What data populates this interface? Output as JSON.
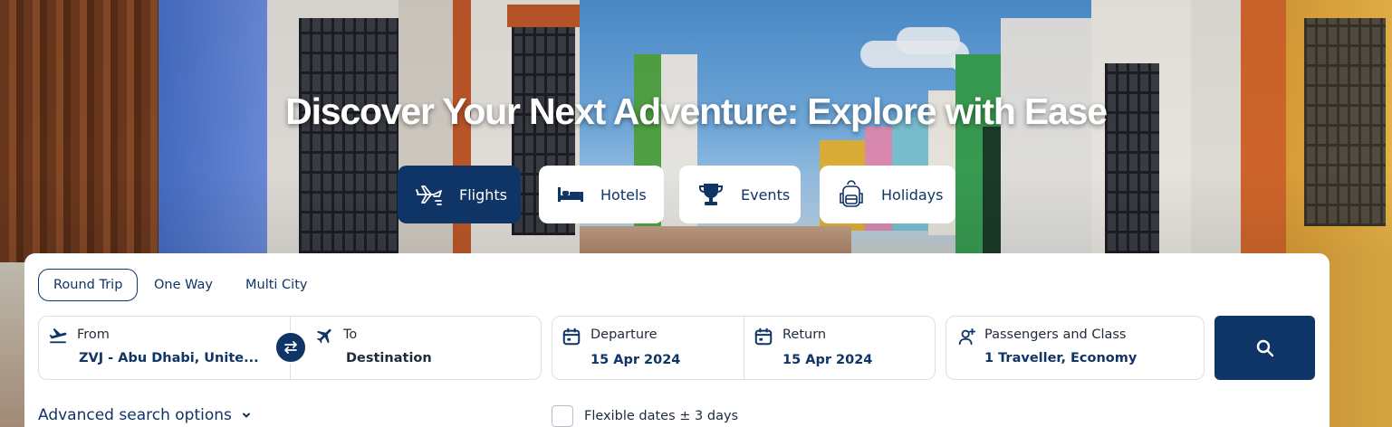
{
  "hero": {
    "headline": "Discover Your Next Adventure: Explore with Ease"
  },
  "categories": [
    {
      "label": "Flights",
      "icon": "plane-icon",
      "active": true
    },
    {
      "label": "Hotels",
      "icon": "bed-icon",
      "active": false
    },
    {
      "label": "Events",
      "icon": "trophy-icon",
      "active": false
    },
    {
      "label": "Holidays",
      "icon": "backpack-icon",
      "active": false
    }
  ],
  "trip_types": [
    {
      "label": "Round Trip",
      "active": true
    },
    {
      "label": "One Way",
      "active": false
    },
    {
      "label": "Multi City",
      "active": false
    }
  ],
  "search": {
    "from": {
      "label": "From",
      "value": "ZVJ - Abu Dhabi, Unite...",
      "icon": "takeoff-icon"
    },
    "to": {
      "label": "To",
      "value": "Destination",
      "icon": "landing-icon"
    },
    "departure": {
      "label": "Departure",
      "value": "15 Apr 2024",
      "icon": "calendar-icon"
    },
    "return": {
      "label": "Return",
      "value": "15 Apr 2024",
      "icon": "calendar-icon"
    },
    "passengers": {
      "label": "Passengers and Class",
      "value": "1 Traveller, Economy",
      "icon": "add-person-icon"
    },
    "swap_icon": "swap-icon",
    "search_icon": "search-icon"
  },
  "options": {
    "advanced_label": "Advanced search options",
    "flexible_dates_label": "Flexible dates ± 3 days",
    "flexible_dates_checked": false
  },
  "colors": {
    "primary": "#0f3466",
    "border": "#dcdfe5",
    "text": "#1f2a3a"
  }
}
